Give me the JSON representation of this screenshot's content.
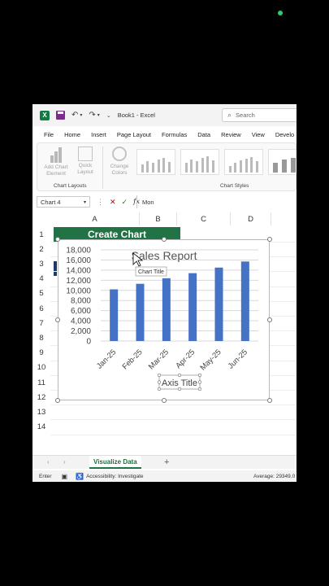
{
  "app": {
    "logo": "X",
    "title": "Book1 - Excel",
    "search_placeholder": "Search",
    "menu": [
      "File",
      "Home",
      "Insert",
      "Page Layout",
      "Formulas",
      "Data",
      "Review",
      "View",
      "Develo"
    ]
  },
  "ribbon": {
    "add_chart_element": "Add Chart Element",
    "quick_layout": "Quick Layout",
    "change_colors": "Change Colors",
    "group_chart_layouts": "Chart Layouts",
    "group_chart_styles": "Chart Styles"
  },
  "formula_bar": {
    "name_box": "Chart 4",
    "fx": "fx",
    "content": "Mon"
  },
  "grid": {
    "columns": [
      "A",
      "B",
      "C",
      "D"
    ],
    "rows": [
      "1",
      "2",
      "3",
      "4",
      "5",
      "6",
      "7",
      "8",
      "9",
      "10",
      "11",
      "12",
      "13",
      "14"
    ],
    "banner_text": "Create Chart"
  },
  "chart_data": {
    "type": "bar",
    "title": "Sales Report",
    "tooltip": "Chart Title",
    "xlabel": "Axis Title",
    "ylabel": "",
    "categories": [
      "Jan-25",
      "Feb-25",
      "Mar-25",
      "Apr-25",
      "May-25",
      "Jun-25"
    ],
    "values": [
      10200,
      11300,
      12400,
      13400,
      14500,
      15700
    ],
    "yticks": [
      "0",
      "2,000",
      "4,000",
      "6,000",
      "8,000",
      "10,000",
      "12,000",
      "14,000",
      "16,000",
      "18,000"
    ],
    "ylim": [
      0,
      18000
    ],
    "grid": true,
    "legend": "none",
    "bar_color": "#4472c4"
  },
  "sheets": {
    "active_tab": "Visualize Data",
    "add_label": "+"
  },
  "status": {
    "mode": "Enter",
    "accessibility": "Accessibility: Investigate",
    "average": "Average: 29349.0"
  },
  "colors": {
    "excel_green": "#217346",
    "banner_green": "#217346",
    "accent_navy": "#1f3864"
  }
}
